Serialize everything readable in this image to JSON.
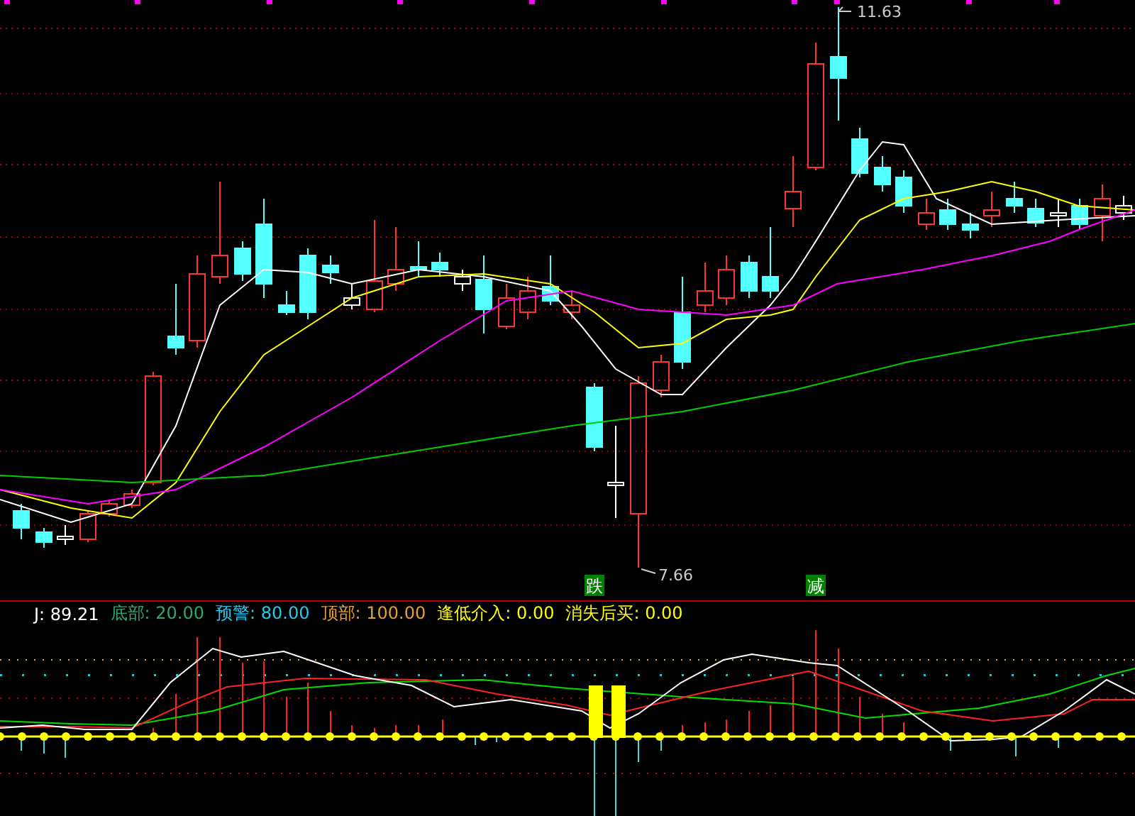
{
  "price_chart": {
    "high_label": "11.63",
    "low_label": "7.66",
    "signals": [
      {
        "label": "跌",
        "color": "#008000"
      },
      {
        "label": "减",
        "color": "#008000"
      }
    ]
  },
  "indicator": {
    "legend": [
      {
        "name": "J:",
        "value": "89.21",
        "color": "#ffffff"
      },
      {
        "name": "底部:",
        "value": "20.00",
        "color": "#2fa86f"
      },
      {
        "name": "预警:",
        "value": "80.00",
        "color": "#22ccee"
      },
      {
        "name": "顶部:",
        "value": "100.00",
        "color": "#e8a030"
      },
      {
        "name": "逢低介入:",
        "value": "0.00",
        "color": "#ffff00"
      },
      {
        "name": "消失后买:",
        "value": "0.00",
        "color": "#ffff00"
      }
    ]
  }
}
